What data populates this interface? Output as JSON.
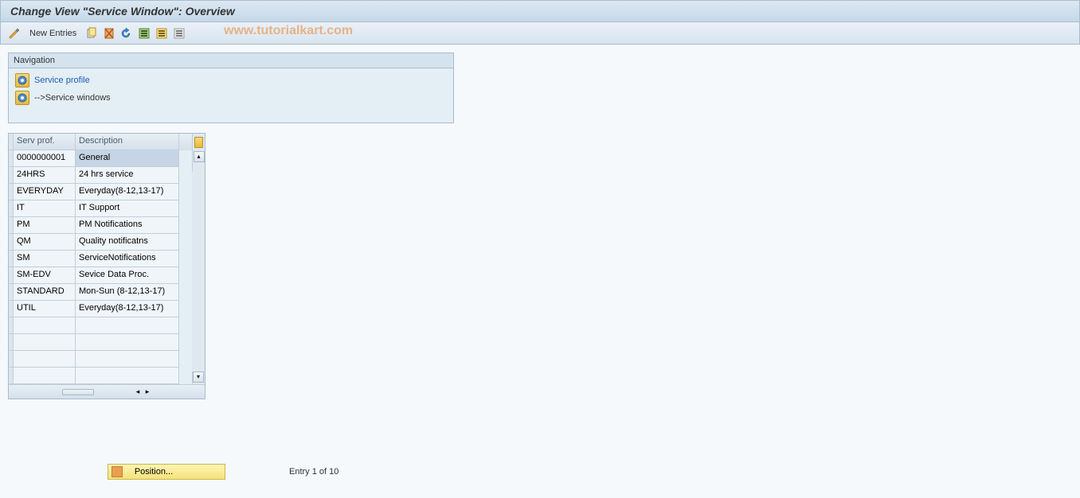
{
  "title": "Change View \"Service Window\": Overview",
  "toolbar": {
    "new_entries_label": "New Entries"
  },
  "watermark": "www.tutorialkart.com",
  "navigation": {
    "header": "Navigation",
    "items": [
      {
        "label": "Service profile",
        "type": "link"
      },
      {
        "label": "-->Service windows",
        "type": "text"
      }
    ]
  },
  "table": {
    "columns": [
      "Serv prof.",
      "Description"
    ],
    "rows": [
      {
        "prof": "0000000001",
        "desc": "General",
        "selected": true
      },
      {
        "prof": "24HRS",
        "desc": "24 hrs service",
        "selected": false
      },
      {
        "prof": "EVERYDAY",
        "desc": "Everyday(8-12,13-17)",
        "selected": false
      },
      {
        "prof": "IT",
        "desc": "IT Support",
        "selected": false
      },
      {
        "prof": "PM",
        "desc": "PM Notifications",
        "selected": false
      },
      {
        "prof": "QM",
        "desc": "Quality notificatns",
        "selected": false
      },
      {
        "prof": "SM",
        "desc": "ServiceNotifications",
        "selected": false
      },
      {
        "prof": "SM-EDV",
        "desc": "Sevice Data Proc.",
        "selected": false
      },
      {
        "prof": "STANDARD",
        "desc": "Mon-Sun (8-12,13-17)",
        "selected": false
      },
      {
        "prof": "UTIL",
        "desc": "Everyday(8-12,13-17)",
        "selected": false
      },
      {
        "prof": "",
        "desc": "",
        "selected": false
      },
      {
        "prof": "",
        "desc": "",
        "selected": false
      },
      {
        "prof": "",
        "desc": "",
        "selected": false
      },
      {
        "prof": "",
        "desc": "",
        "selected": false
      }
    ]
  },
  "footer": {
    "position_label": "Position...",
    "entry_text": "Entry 1 of 10"
  }
}
